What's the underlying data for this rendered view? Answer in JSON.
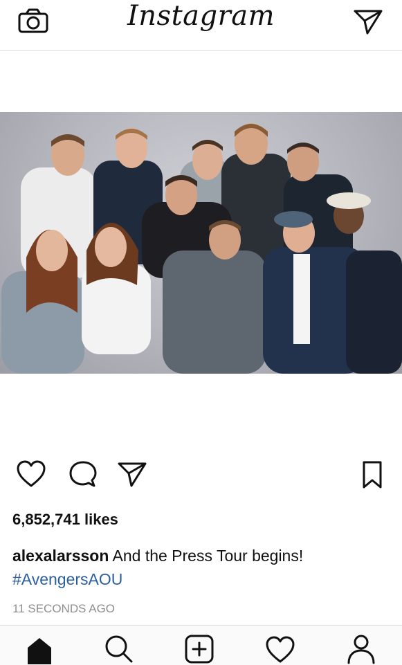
{
  "header": {
    "title": "Instagram",
    "camera_icon": "camera-icon",
    "direct_icon": "paper-plane-icon"
  },
  "post": {
    "image_alt": "Group photo of the Avengers cast",
    "likes": "6,852,741 likes",
    "caption": {
      "username": "alexalarsson",
      "text": "And the Press Tour begins!",
      "hashtag": "#AvengersAOU"
    },
    "time_ago": "11 SECONDS AGO",
    "actions": [
      "heart-icon",
      "comment-icon",
      "share-icon",
      "bookmark-icon"
    ]
  },
  "tabbar": {
    "items": [
      "home-icon",
      "search-icon",
      "new-post-icon",
      "activity-heart-icon",
      "profile-icon"
    ],
    "active": "home-icon"
  },
  "colors": {
    "hashtag": "#2b5f9f",
    "muted": "#8e8e8e",
    "divider": "#d9d9d9"
  }
}
